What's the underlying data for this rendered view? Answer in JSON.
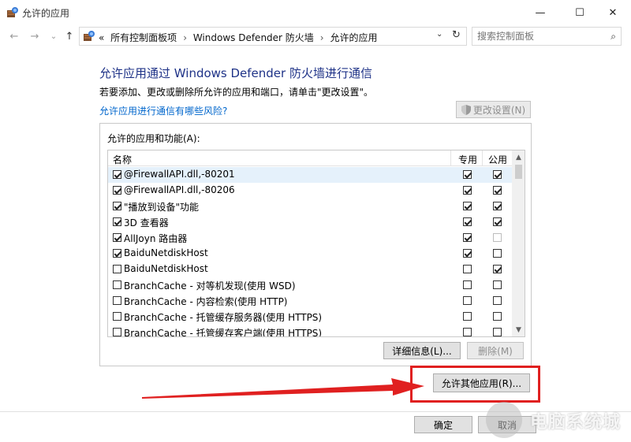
{
  "window": {
    "title": "允许的应用",
    "minimize": "—",
    "maximize": "☐",
    "close": "✕"
  },
  "nav": {
    "back": "←",
    "forward": "→",
    "recent": "⌄",
    "up": "↑"
  },
  "address": {
    "overflow": "«",
    "crumbs": [
      "所有控制面板项",
      "Windows Defender 防火墙",
      "允许的应用"
    ],
    "separator": "›",
    "dropdown": "⌄",
    "refresh": "↻"
  },
  "search": {
    "placeholder": "搜索控制面板",
    "icon": "⌕"
  },
  "content": {
    "heading": "允许应用通过 Windows Defender 防火墙进行通信",
    "description": "若要添加、更改或删除所允许的应用和端口，请单击\"更改设置\"。",
    "risk_link": "允许应用进行通信有哪些风险?",
    "change_settings": "更改设置(N)",
    "group_label": "允许的应用和功能(A):",
    "columns": {
      "name": "名称",
      "private": "专用",
      "public": "公用"
    },
    "rows": [
      {
        "name": "@FirewallAPI.dll,-80201",
        "enabled": true,
        "private": true,
        "public": true,
        "public_disabled": false
      },
      {
        "name": "@FirewallAPI.dll,-80206",
        "enabled": true,
        "private": true,
        "public": true,
        "public_disabled": false
      },
      {
        "name": "\"播放到设备\"功能",
        "enabled": true,
        "private": true,
        "public": true,
        "public_disabled": false
      },
      {
        "name": "3D 查看器",
        "enabled": true,
        "private": true,
        "public": true,
        "public_disabled": false
      },
      {
        "name": "AllJoyn 路由器",
        "enabled": true,
        "private": true,
        "public": false,
        "public_disabled": true
      },
      {
        "name": "BaiduNetdiskHost",
        "enabled": true,
        "private": true,
        "public": false,
        "public_disabled": false
      },
      {
        "name": "BaiduNetdiskHost",
        "enabled": false,
        "private": false,
        "public": true,
        "public_disabled": false
      },
      {
        "name": "BranchCache - 对等机发现(使用 WSD)",
        "enabled": false,
        "private": false,
        "public": false,
        "public_disabled": false
      },
      {
        "name": "BranchCache - 内容检索(使用 HTTP)",
        "enabled": false,
        "private": false,
        "public": false,
        "public_disabled": false
      },
      {
        "name": "BranchCache - 托管缓存服务器(使用 HTTPS)",
        "enabled": false,
        "private": false,
        "public": false,
        "public_disabled": false
      },
      {
        "name": "BranchCache - 托管缓存客户端(使用 HTTPS)",
        "enabled": false,
        "private": false,
        "public": false,
        "public_disabled": false
      }
    ],
    "details_button": "详细信息(L)...",
    "delete_button": "删除(M)",
    "allow_other_button": "允许其他应用(R)...",
    "ok_button": "确定",
    "cancel_button": "取消"
  },
  "scrollbar": {
    "up": "▲",
    "down": "▼"
  },
  "watermark": {
    "text": "电脑系统城"
  },
  "colors": {
    "heading": "#1e3287",
    "link": "#0066cc",
    "highlight": "#e02020",
    "selected_row": "#e5f1fb"
  }
}
